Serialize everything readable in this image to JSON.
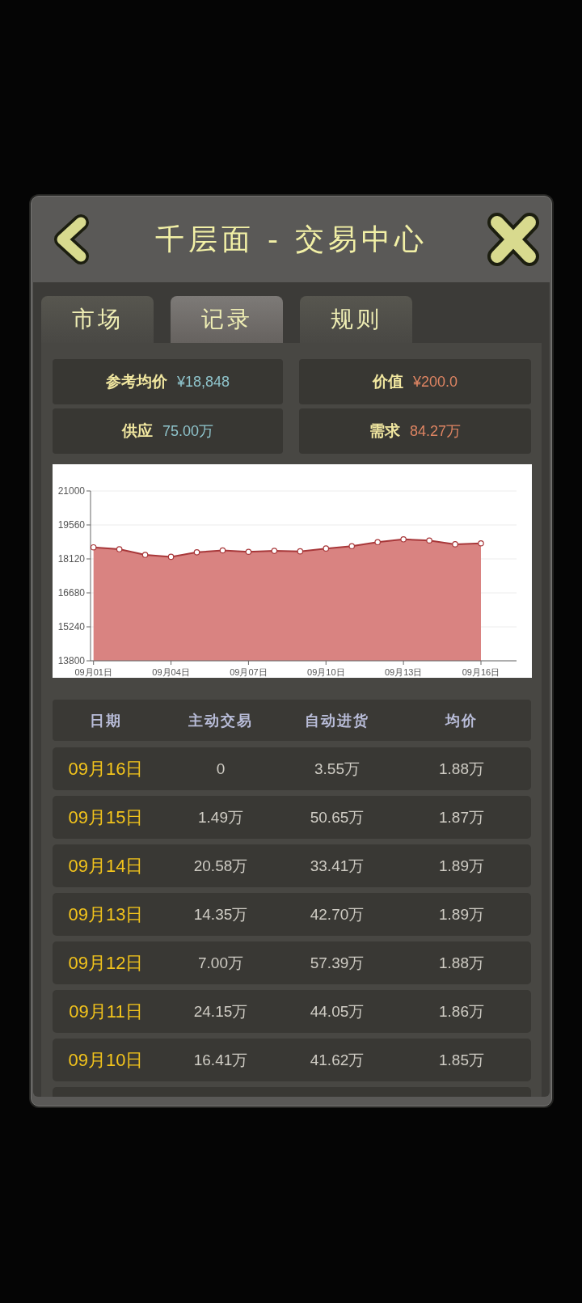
{
  "header": {
    "title": "千层面 - 交易中心"
  },
  "tabs": [
    {
      "label": "市场",
      "selected": false
    },
    {
      "label": "记录",
      "selected": true
    },
    {
      "label": "规则",
      "selected": false
    }
  ],
  "stats": [
    {
      "label": "参考均价",
      "value": "¥18,848",
      "color": "#8fc4cc"
    },
    {
      "label": "价值",
      "value": "¥200.0",
      "color": "#df8563"
    },
    {
      "label": "供应",
      "value": "75.00万",
      "color": "#8fc4cc"
    },
    {
      "label": "需求",
      "value": "84.27万",
      "color": "#df8563"
    }
  ],
  "chart": {
    "chart_data": {
      "type": "area",
      "categories": [
        "09月01日",
        null,
        null,
        "09月04日",
        null,
        null,
        "09月07日",
        null,
        null,
        "09月10日",
        null,
        null,
        "09月13日",
        null,
        null,
        "09月16日"
      ],
      "values": [
        18610,
        18530,
        18290,
        18210,
        18400,
        18480,
        18420,
        18460,
        18440,
        18560,
        18660,
        18830,
        18950,
        18900,
        18740,
        18780
      ],
      "ylim": [
        13800,
        21000
      ],
      "yticks": [
        13800,
        15240,
        16680,
        18120,
        19560,
        21000
      ],
      "grid": true
    }
  },
  "table": {
    "columns": [
      "日期",
      "主动交易",
      "自动进货",
      "均价"
    ],
    "rows": [
      [
        "09月16日",
        "0",
        "3.55万",
        "1.88万"
      ],
      [
        "09月15日",
        "1.49万",
        "50.65万",
        "1.87万"
      ],
      [
        "09月14日",
        "20.58万",
        "33.41万",
        "1.89万"
      ],
      [
        "09月13日",
        "14.35万",
        "42.70万",
        "1.89万"
      ],
      [
        "09月12日",
        "7.00万",
        "57.39万",
        "1.88万"
      ],
      [
        "09月11日",
        "24.15万",
        "44.05万",
        "1.86万"
      ],
      [
        "09月10日",
        "16.41万",
        "41.62万",
        "1.85万"
      ]
    ]
  }
}
